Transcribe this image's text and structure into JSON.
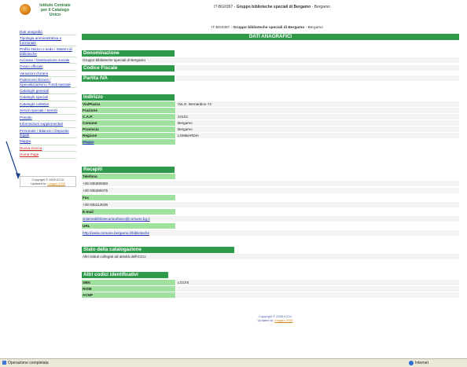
{
  "logo": {
    "line1": "Istituto Centrale",
    "line2": "per il Catalogo",
    "line3": "Unico"
  },
  "sidebar": {
    "items": [
      "Dati anagrafici",
      "Tipologia amministrativa e funzionale",
      "Profilo storico e sede / Sistemi di biblioteche",
      "Accesso / Destinazione sociale",
      "Orario ufficiale",
      "Variazioni d'orario",
      "Patrimonio librario / Specializzazioni / Fondi speciali",
      "Cataloghi generali",
      "Cataloghi speciali",
      "Cataloghi collettivi",
      "Servizi speciali / Servizi",
      "Prestito",
      "Informazioni supplementari",
      "Personale / Bilancio / Deposito legale",
      "Mappa"
    ],
    "red_items": [
      "Nuova ricerca",
      "Home Page"
    ],
    "copyright": "Copyright © 2005 ICCU",
    "updated_label": "Updated to:",
    "updated_link": "maggio 2005"
  },
  "topbar": {
    "code": "IT-BG0367",
    "name": "Gruppo biblioteche speciali di Bergamo",
    "city": "Bergamo"
  },
  "header": {
    "code": "IT-BG0367",
    "name": "Gruppo biblioteche speciali di Bergamo",
    "city": "Bergamo"
  },
  "banner": "DATI ANAGRAFICI",
  "sections": {
    "denominazione": {
      "title": "Denominazione",
      "value": "Gruppo biblioteche speciali di Bergamo"
    },
    "codice_fiscale": {
      "title": "Codice Fiscale"
    },
    "partita_iva": {
      "title": "Partita IVA"
    },
    "indirizzo": {
      "title": "Indirizzo",
      "via_label": "Via/Piazza",
      "via": "Via G. Bernardino 74",
      "frazione_label": "Frazione",
      "frazione": "",
      "cap_label": "C.A.P.",
      "cap": "24122",
      "comune_label": "Comune",
      "comune": "Bergamo",
      "provincia_label": "Provincia",
      "provincia": "Bergamo",
      "regione_label": "Regione",
      "regione": "LOMBARDIA",
      "mappa": "Mappa"
    },
    "recapiti": {
      "title": "Recapiti",
      "telefono_label": "Telefono",
      "telefono1": "+39 035399360",
      "telefono2": "+39 035399475",
      "fax_label": "Fax",
      "fax": "+39 035212036",
      "email_label": "E-mail",
      "email": "sistemabibliotecariourbano@comune.bg.it",
      "url_label": "URL",
      "url": "http://www.comune.bergamo.it/biblioteche"
    },
    "stato": {
      "title": "Stato della catalogazione",
      "value": "Altri istituti collegati ad attività dell'ICCU"
    },
    "altri_codici": {
      "title": "Altri codici identificativi",
      "sbn_label": "SBN",
      "sbn": "LO1X0",
      "rism_label": "RISM",
      "rism": "",
      "acnp_label": "ACNP",
      "acnp": ""
    }
  },
  "footer": {
    "copyright": "Copyright © 2005 ICCU",
    "updated_label": "Updated to:",
    "updated_link": "maggio 2005"
  },
  "statusbar": {
    "left": "Operazione completata",
    "right": "Internet"
  }
}
